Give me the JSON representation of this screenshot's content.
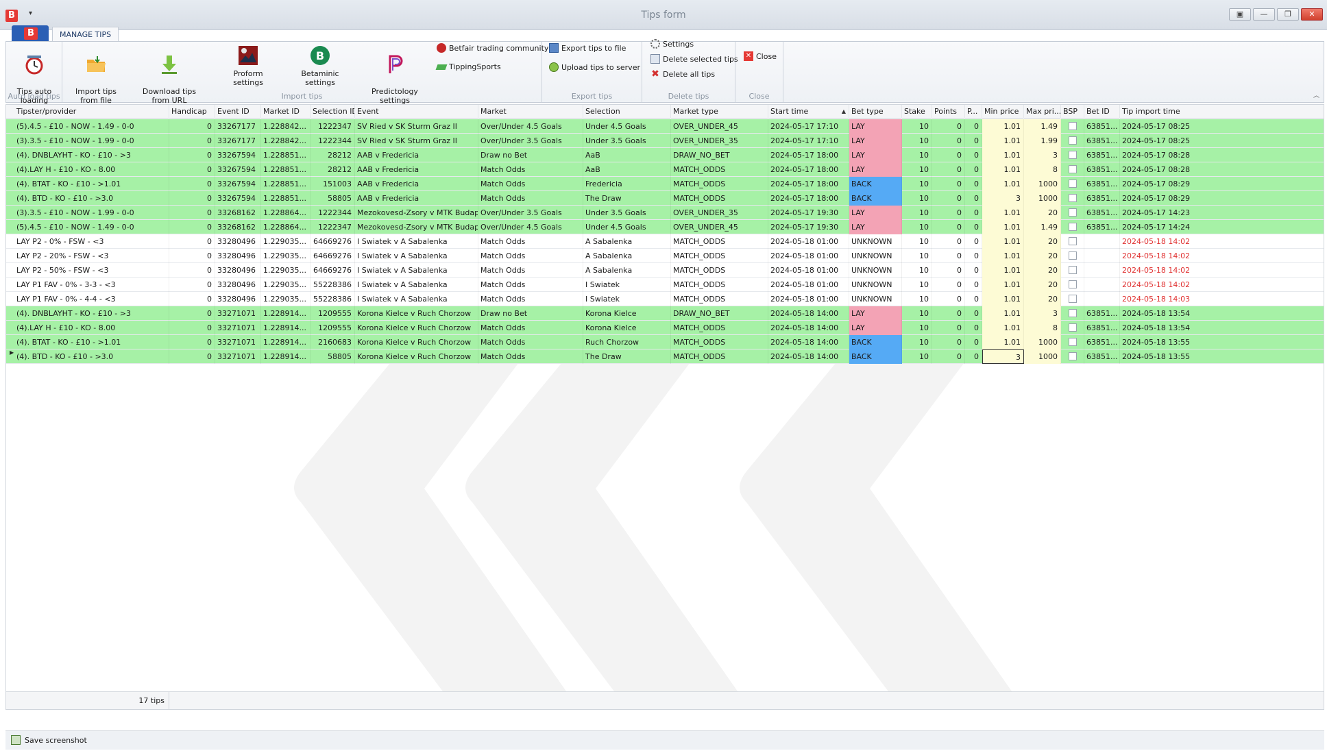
{
  "window": {
    "title": "Tips form"
  },
  "ribbon": {
    "tab": "MANAGE TIPS",
    "groups": {
      "auto_load": {
        "label": "Auto load tips",
        "tips_auto_loading": "Tips auto\nloading"
      },
      "import": {
        "label": "Import tips",
        "import_from_file": "Import tips\nfrom file",
        "download_from_url": "Download tips\nfrom URL",
        "proform_settings": "Proform settings",
        "betaminic_settings": "Betaminic settings",
        "predictology_settings": "Predictology\nsettings",
        "betfair_trading_community": "Betfair trading community",
        "tipping_sports": "TippingSports"
      },
      "export": {
        "label": "Export tips",
        "export_to_file": "Export tips to file",
        "upload_to_server": "Upload tips to server"
      },
      "delete": {
        "label": "Delete tips",
        "settings": "Settings",
        "delete_selected": "Delete selected tips",
        "delete_all": "Delete all tips"
      },
      "close": {
        "label": "Close",
        "close": "Close"
      }
    }
  },
  "grid": {
    "columns": [
      "Tipster/provider",
      "Handicap",
      "Event ID",
      "Market ID",
      "Selection ID",
      "Event",
      "Market",
      "Selection",
      "Market type",
      "Start time",
      "Bet type",
      "Stake",
      "Points",
      "P...",
      "Min price",
      "Max pri...",
      "BSP",
      "Bet ID",
      "Tip import time"
    ],
    "rows": [
      [
        "(5).4.5 - £10 - NOW - 1.49 - 0-0",
        "0",
        "33267177",
        "1.228842...",
        "1222347",
        "SV Ried v SK Sturm Graz II",
        "Over/Under 4.5 Goals",
        "Under 4.5 Goals",
        "OVER_UNDER_45",
        "2024-05-17 17:10",
        "LAY",
        "10",
        "0",
        "0",
        "1.01",
        "1.49",
        "",
        "63851...",
        "2024-05-17 08:25"
      ],
      [
        "(3).3.5 - £10 - NOW - 1.99 - 0-0",
        "0",
        "33267177",
        "1.228842...",
        "1222344",
        "SV Ried v SK Sturm Graz II",
        "Over/Under 3.5 Goals",
        "Under 3.5 Goals",
        "OVER_UNDER_35",
        "2024-05-17 17:10",
        "LAY",
        "10",
        "0",
        "0",
        "1.01",
        "1.99",
        "",
        "63851...",
        "2024-05-17 08:25"
      ],
      [
        "(4). DNBLAYHT - KO - £10 - >3",
        "0",
        "33267594",
        "1.228851...",
        "28212",
        "AAB v Fredericia",
        "Draw no Bet",
        "AaB",
        "DRAW_NO_BET",
        "2024-05-17 18:00",
        "LAY",
        "10",
        "0",
        "0",
        "1.01",
        "3",
        "",
        "63851...",
        "2024-05-17 08:28"
      ],
      [
        "(4).LAY H - £10 - KO - 8.00",
        "0",
        "33267594",
        "1.228851...",
        "28212",
        "AAB v Fredericia",
        "Match Odds",
        "AaB",
        "MATCH_ODDS",
        "2024-05-17 18:00",
        "LAY",
        "10",
        "0",
        "0",
        "1.01",
        "8",
        "",
        "63851...",
        "2024-05-17 08:28"
      ],
      [
        "(4). BTAT - KO - £10 - >1.01",
        "0",
        "33267594",
        "1.228851...",
        "151003",
        "AAB v Fredericia",
        "Match Odds",
        "Fredericia",
        "MATCH_ODDS",
        "2024-05-17 18:00",
        "BACK",
        "10",
        "0",
        "0",
        "1.01",
        "1000",
        "",
        "63851...",
        "2024-05-17 08:29"
      ],
      [
        "(4). BTD - KO - £10 - >3.0",
        "0",
        "33267594",
        "1.228851...",
        "58805",
        "AAB v Fredericia",
        "Match Odds",
        "The Draw",
        "MATCH_ODDS",
        "2024-05-17 18:00",
        "BACK",
        "10",
        "0",
        "0",
        "3",
        "1000",
        "",
        "63851...",
        "2024-05-17 08:29"
      ],
      [
        "(3).3.5 - £10 - NOW - 1.99 - 0-0",
        "0",
        "33268162",
        "1.228864...",
        "1222344",
        "Mezokovesd-Zsory v MTK Budapest",
        "Over/Under 3.5 Goals",
        "Under 3.5 Goals",
        "OVER_UNDER_35",
        "2024-05-17 19:30",
        "LAY",
        "10",
        "0",
        "0",
        "1.01",
        "20",
        "",
        "63851...",
        "2024-05-17 14:23"
      ],
      [
        "(5).4.5 - £10 - NOW - 1.49 - 0-0",
        "0",
        "33268162",
        "1.228864...",
        "1222347",
        "Mezokovesd-Zsory v MTK Budapest",
        "Over/Under 4.5 Goals",
        "Under 4.5 Goals",
        "OVER_UNDER_45",
        "2024-05-17 19:30",
        "LAY",
        "10",
        "0",
        "0",
        "1.01",
        "1.49",
        "",
        "63851...",
        "2024-05-17 14:24"
      ],
      [
        "LAY P2 - 0% - FSW - <3",
        "0",
        "33280496",
        "1.229035...",
        "64669276",
        "I Swiatek v A Sabalenka",
        "Match Odds",
        "A Sabalenka",
        "MATCH_ODDS",
        "2024-05-18 01:00",
        "UNKNOWN",
        "10",
        "0",
        "0",
        "1.01",
        "20",
        "",
        "",
        "2024-05-18 14:02"
      ],
      [
        "LAY P2 - 20% - FSW - <3",
        "0",
        "33280496",
        "1.229035...",
        "64669276",
        "I Swiatek v A Sabalenka",
        "Match Odds",
        "A Sabalenka",
        "MATCH_ODDS",
        "2024-05-18 01:00",
        "UNKNOWN",
        "10",
        "0",
        "0",
        "1.01",
        "20",
        "",
        "",
        "2024-05-18 14:02"
      ],
      [
        "LAY P2 - 50% - FSW - <3",
        "0",
        "33280496",
        "1.229035...",
        "64669276",
        "I Swiatek v A Sabalenka",
        "Match Odds",
        "A Sabalenka",
        "MATCH_ODDS",
        "2024-05-18 01:00",
        "UNKNOWN",
        "10",
        "0",
        "0",
        "1.01",
        "20",
        "",
        "",
        "2024-05-18 14:02"
      ],
      [
        "LAY P1 FAV - 0% - 3-3 - <3",
        "0",
        "33280496",
        "1.229035...",
        "55228386",
        "I Swiatek v A Sabalenka",
        "Match Odds",
        "I Swiatek",
        "MATCH_ODDS",
        "2024-05-18 01:00",
        "UNKNOWN",
        "10",
        "0",
        "0",
        "1.01",
        "20",
        "",
        "",
        "2024-05-18 14:02"
      ],
      [
        "LAY P1 FAV - 0% - 4-4 - <3",
        "0",
        "33280496",
        "1.229035...",
        "55228386",
        "I Swiatek v A Sabalenka",
        "Match Odds",
        "I Swiatek",
        "MATCH_ODDS",
        "2024-05-18 01:00",
        "UNKNOWN",
        "10",
        "0",
        "0",
        "1.01",
        "20",
        "",
        "",
        "2024-05-18 14:03"
      ],
      [
        "(4). DNBLAYHT - KO - £10 - >3",
        "0",
        "33271071",
        "1.228914...",
        "1209555",
        "Korona Kielce v Ruch Chorzow",
        "Draw no Bet",
        "Korona Kielce",
        "DRAW_NO_BET",
        "2024-05-18 14:00",
        "LAY",
        "10",
        "0",
        "0",
        "1.01",
        "3",
        "",
        "63851...",
        "2024-05-18 13:54"
      ],
      [
        "(4).LAY H - £10 - KO - 8.00",
        "0",
        "33271071",
        "1.228914...",
        "1209555",
        "Korona Kielce v Ruch Chorzow",
        "Match Odds",
        "Korona Kielce",
        "MATCH_ODDS",
        "2024-05-18 14:00",
        "LAY",
        "10",
        "0",
        "0",
        "1.01",
        "8",
        "",
        "63851...",
        "2024-05-18 13:54"
      ],
      [
        "(4). BTAT - KO - £10 - >1.01",
        "0",
        "33271071",
        "1.228914...",
        "2160683",
        "Korona Kielce v Ruch Chorzow",
        "Match Odds",
        "Ruch Chorzow",
        "MATCH_ODDS",
        "2024-05-18 14:00",
        "BACK",
        "10",
        "0",
        "0",
        "1.01",
        "1000",
        "",
        "63851...",
        "2024-05-18 13:55"
      ],
      [
        "(4). BTD - KO - £10 - >3.0",
        "0",
        "33271071",
        "1.228914...",
        "58805",
        "Korona Kielce v Ruch Chorzow",
        "Match Odds",
        "The Draw",
        "MATCH_ODDS",
        "2024-05-18 14:00",
        "BACK",
        "10",
        "0",
        "0",
        "3",
        "1000",
        "",
        "63851...",
        "2024-05-18 13:55"
      ]
    ],
    "footer_count": "17 tips"
  },
  "statusbar": {
    "save_screenshot": "Save screenshot"
  },
  "colors": {
    "matched_row": "#a6f1a6",
    "lay": "#f3a3b5",
    "back": "#55aaf5",
    "pending_time": "#e03030"
  }
}
